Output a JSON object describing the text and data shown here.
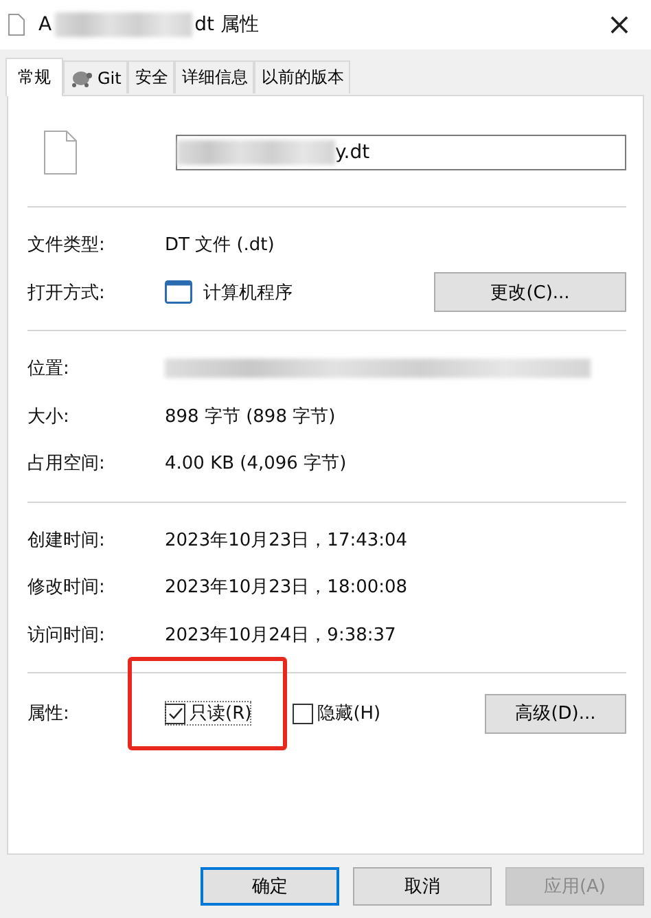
{
  "window": {
    "title_start": "A",
    "title_end": "dt 属性",
    "close": "×"
  },
  "tabs": [
    {
      "label": "常规",
      "selected": true,
      "icon": false
    },
    {
      "label": "Git",
      "selected": false,
      "icon": true
    },
    {
      "label": "安全",
      "selected": false,
      "icon": false
    },
    {
      "label": "详细信息",
      "selected": false,
      "icon": false
    },
    {
      "label": "以前的版本",
      "selected": false,
      "icon": false
    }
  ],
  "file_name_end": "y.dt",
  "groups": [
    [
      {
        "kind": "text",
        "label": "文件类型:",
        "value": "DT 文件 (.dt)"
      },
      {
        "kind": "app",
        "label": "打开方式:",
        "value": "计算机程序",
        "button": "更改(C)..."
      }
    ],
    [
      {
        "kind": "blurred",
        "label": "位置:"
      },
      {
        "kind": "text",
        "label": "大小:",
        "value": "898 字节 (898 字节)"
      },
      {
        "kind": "text",
        "label": "占用空间:",
        "value": "4.00 KB (4,096 字节)"
      }
    ],
    [
      {
        "kind": "text",
        "label": "创建时间:",
        "value": "2023年10月23日，17:43:04"
      },
      {
        "kind": "text",
        "label": "修改时间:",
        "value": "2023年10月23日，18:00:08"
      },
      {
        "kind": "text",
        "label": "访问时间:",
        "value": "2023年10月24日，9:38:37"
      }
    ]
  ],
  "attributes": {
    "label": "属性:",
    "options": [
      {
        "label": "只读(R)",
        "checked": true,
        "highlighted": true
      },
      {
        "label": "隐藏(H)",
        "checked": false,
        "highlighted": false
      }
    ],
    "button": "高级(D)..."
  },
  "buttons": [
    {
      "label": "确定",
      "kind": "default"
    },
    {
      "label": "取消",
      "kind": "normal"
    },
    {
      "label": "应用(A)",
      "kind": "disabled"
    }
  ]
}
